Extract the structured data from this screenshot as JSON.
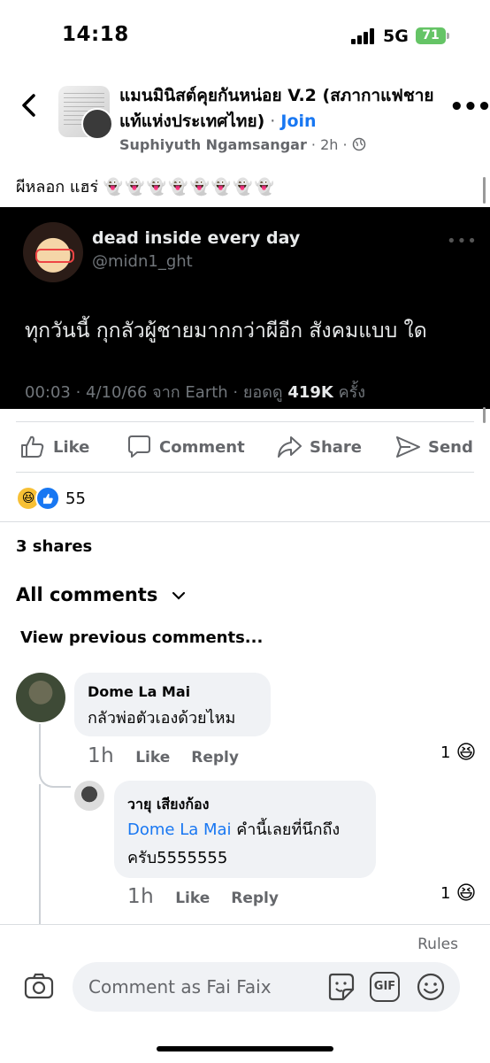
{
  "status_bar": {
    "time": "14:18",
    "network": "5G",
    "battery": "71"
  },
  "header": {
    "group_name": "แมนมินิสต์คุยกันหน่อย V.2 (สภากาแฟชายแท้แห่งประเทศไทย)",
    "separator": " · ",
    "join_label": "Join",
    "poster_name": "Suphiyuth Ngamsangar",
    "time_ago": " · 2h · ",
    "more_label": "•••"
  },
  "post": {
    "caption_text": "ผีหลอก แฮร่ ",
    "caption_emoji": "👻👻👻👻👻👻👻👻"
  },
  "tweet": {
    "display_name": "dead inside every day",
    "handle": "@midn1_ght",
    "more": "•••",
    "text": "ทุกวันนี้ กุกลัวผู้ชายมากกว่าผีอีก สังคมแบบ ใด",
    "meta_prefix": "00:03 · 4/10/66 จาก Earth · ยอดดู ",
    "views": "419K",
    "meta_suffix": " ครั้ง"
  },
  "actions": {
    "like": "Like",
    "comment": "Comment",
    "share": "Share",
    "send": "Send"
  },
  "reactions": {
    "count": "55"
  },
  "shares_text": "3 shares",
  "all_comments_label": "All comments",
  "view_previous": "View previous comments...",
  "comments": [
    {
      "author": "Dome La Mai",
      "text": "กลัวพ่อตัวเองด้วยไหม",
      "time": "1h",
      "like": "Like",
      "reply": "Reply",
      "reaction_count": "1"
    },
    {
      "author": "วายุ เสียงก้อง",
      "mention": "Dome La Mai",
      "text_line1": " คำนี้เลยที่นึกถึง",
      "text_line2": "ครับ5555555",
      "time": "1h",
      "like": "Like",
      "reply": "Reply",
      "reaction_count": "1"
    }
  ],
  "bottom": {
    "rules": "Rules",
    "comment_placeholder": "Comment as Fai Faix",
    "gif_label": "GIF"
  },
  "colors": {
    "accent": "#1877f2",
    "meta_gray": "#65676b",
    "bubble": "#f0f2f5"
  },
  "icons": [
    "back-arrow-icon",
    "more-icon",
    "like-icon",
    "comment-icon",
    "share-icon",
    "send-icon",
    "haha-reaction-icon",
    "like-reaction-icon",
    "chevron-down-icon",
    "camera-icon",
    "sticker-icon",
    "gif-icon",
    "emoji-icon"
  ]
}
